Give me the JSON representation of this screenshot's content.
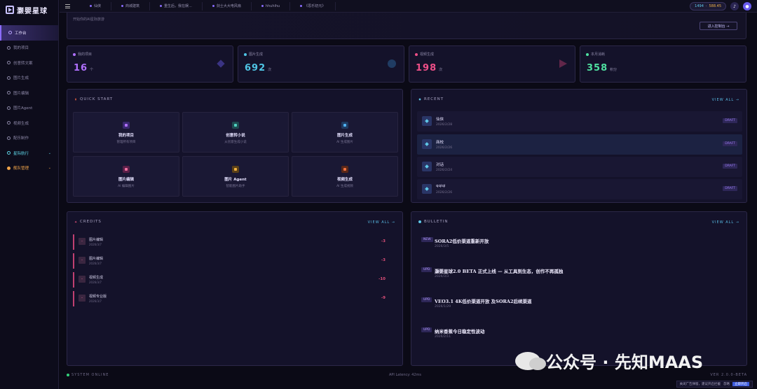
{
  "app": {
    "name": "灏婴星球"
  },
  "sidebar": {
    "items": [
      {
        "label": "工作台",
        "state": "active"
      },
      {
        "label": "我的项目"
      },
      {
        "label": "创意转文案"
      },
      {
        "label": "图片生成"
      },
      {
        "label": "图片编辑"
      },
      {
        "label": "图片Agent"
      },
      {
        "label": "视频生成"
      },
      {
        "label": "配乐制作"
      },
      {
        "label": "星际航行",
        "accent": "cyan"
      },
      {
        "label": "舰队管理",
        "accent": "orange"
      }
    ]
  },
  "topbar": {
    "tabs": [
      "仙侠",
      "商城建筑",
      "重生后，我在娱...",
      "剑士大大电风扇",
      "hhuhihu",
      "《思乐初元》"
    ],
    "credits_a": "1494",
    "credits_b": "588.45"
  },
  "hero": {
    "subtitle": "开始你的AI星际旅游",
    "button": "进入控制台 →"
  },
  "stats": [
    {
      "label": "我的项目",
      "value": "16",
      "unit": "个",
      "color": "#b070ff"
    },
    {
      "label": "图片生成",
      "value": "692",
      "unit": "次",
      "color": "#4fc4e4"
    },
    {
      "label": "视频生成",
      "value": "198",
      "unit": "次",
      "color": "#ee4f88"
    },
    {
      "label": "本月消耗",
      "value": "358",
      "unit": "积分",
      "color": "#4fe0a0"
    }
  ],
  "quick_start": {
    "title": "QUICK START",
    "cards": [
      {
        "name": "我的项目",
        "desc": "管理所有项目",
        "color": "#7a4fd8"
      },
      {
        "name": "创意转小说",
        "desc": "从创意生成小说",
        "color": "#2fa0a8"
      },
      {
        "name": "图片生成",
        "desc": "AI 生成图片",
        "color": "#2f88c8"
      },
      {
        "name": "图片编辑",
        "desc": "AI 编辑图片",
        "color": "#d04080"
      },
      {
        "name": "图片 Agent",
        "desc": "智能图片助手",
        "color": "#d09030"
      },
      {
        "name": "视频生成",
        "desc": "AI 生成视频",
        "color": "#e06030"
      }
    ]
  },
  "recent": {
    "title": "RECENT",
    "view_all": "VIEW ALL →",
    "items": [
      {
        "name": "仙侠",
        "date": "2026/2/28",
        "badge": "DRAFT"
      },
      {
        "name": "商校",
        "date": "2026/2/26",
        "badge": "DRAFT"
      },
      {
        "name": "对话",
        "date": "2026/2/24",
        "badge": "DRAFT"
      },
      {
        "name": "qqiqi",
        "date": "2026/2/26",
        "badge": "DRAFT"
      }
    ]
  },
  "credits": {
    "title": "CREDITS",
    "view_all": "VIEW ALL →",
    "items": [
      {
        "name": "图片编辑",
        "date": "2026/3/7",
        "amount": "-3"
      },
      {
        "name": "图片编辑",
        "date": "2026/3/7",
        "amount": "-3"
      },
      {
        "name": "视频生成",
        "date": "2026/3/7",
        "amount": "-10"
      },
      {
        "name": "视频专业版",
        "date": "2026/3/7",
        "amount": "-9"
      }
    ]
  },
  "bulletin": {
    "title": "BULLETIN",
    "view_all": "VIEW ALL →",
    "items": [
      {
        "tag": "NEW",
        "title": "SORA2低价渠道重新开放",
        "date": "2026/3/5"
      },
      {
        "tag": "UPD",
        "title": "灏婴星球2.0 BETA 正式上线 — 从工具到生态，创作不再孤独",
        "date": "2026/3/3"
      },
      {
        "tag": "UPD",
        "title": "VEO3.1 4K低价渠道开放 及SORA2后续渠道",
        "date": "2026/1/29"
      },
      {
        "tag": "UPD",
        "title": "纳米香蕉今日稳定性波动",
        "date": "2026/2/11"
      }
    ]
  },
  "footer": {
    "status": "SYSTEM ONLINE",
    "latency": "API Latency: 42ms",
    "version": "VER 2.0.0-BETA",
    "ad_text": "关闭广告弹窗，建议开启拦截",
    "ad_link": "忽略",
    "ad_button": "立即开启"
  },
  "watermark": "公众号 · 先知MAAS"
}
